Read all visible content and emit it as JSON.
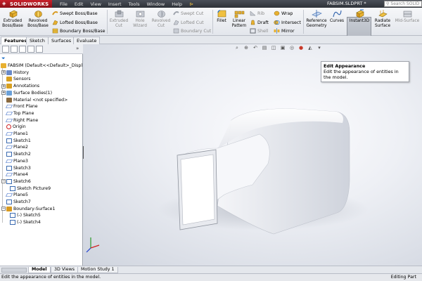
{
  "app": {
    "brand": "SOLIDWORKS",
    "document_title": "FABSIM.SLDPRT *",
    "search_placeholder": "Search SOLID"
  },
  "menu": {
    "items": [
      "File",
      "Edit",
      "View",
      "Insert",
      "Tools",
      "Window",
      "Help"
    ],
    "pin_icon": "pushpin-icon"
  },
  "ribbon": {
    "extruded_boss": "Extruded Boss/Base",
    "revolved_boss": "Revolved Boss/Base",
    "swept_boss": "Swept Boss/Base",
    "lofted_boss": "Lofted Boss/Base",
    "boundary_boss": "Boundary Boss/Base",
    "extruded_cut": "Extruded Cut",
    "hole_wizard": "Hole Wizard",
    "revolved_cut": "Revolved Cut",
    "swept_cut": "Swept Cut",
    "lofted_cut": "Lofted Cut",
    "boundary_cut": "Boundary Cut",
    "fillet": "Fillet",
    "linear_pattern": "Linear Pattern",
    "rib": "Rib",
    "draft": "Draft",
    "shell": "Shell",
    "wrap": "Wrap",
    "intersect": "Intersect",
    "mirror": "Mirror",
    "reference_geometry": "Reference Geometry",
    "curves": "Curves",
    "instant3d": "Instant3D",
    "radiate_surface": "Radiate Surface",
    "mid_surface": "Mid-Surface"
  },
  "tabs": [
    "Features",
    "Sketch",
    "Surfaces",
    "Evaluate"
  ],
  "tree": [
    {
      "label": "FABSIM  (Default<<Default>_Displ",
      "icon": "part-icon",
      "indent": 0
    },
    {
      "label": "History",
      "icon": "history-icon",
      "indent": 1,
      "expandable": true
    },
    {
      "label": "Sensors",
      "icon": "sensor-icon",
      "indent": 1
    },
    {
      "label": "Annotations",
      "icon": "annotations-icon",
      "indent": 1,
      "expandable": true
    },
    {
      "label": "Surface Bodies(1)",
      "icon": "surface-bodies-icon",
      "indent": 1,
      "expandable": true
    },
    {
      "label": "Material <not specified>",
      "icon": "material-icon",
      "indent": 1
    },
    {
      "label": "Front Plane",
      "icon": "plane-icon",
      "indent": 1
    },
    {
      "label": "Top Plane",
      "icon": "plane-icon",
      "indent": 1
    },
    {
      "label": "Right Plane",
      "icon": "plane-icon",
      "indent": 1
    },
    {
      "label": "Origin",
      "icon": "origin-icon",
      "indent": 1
    },
    {
      "label": "Plane1",
      "icon": "plane-icon",
      "indent": 1
    },
    {
      "label": "Sketch1",
      "icon": "sketch-icon",
      "indent": 1
    },
    {
      "label": "Plane2",
      "icon": "plane-icon",
      "indent": 1
    },
    {
      "label": "Sketch2",
      "icon": "sketch-icon",
      "indent": 1
    },
    {
      "label": "Plane3",
      "icon": "plane-icon",
      "indent": 1
    },
    {
      "label": "Sketch3",
      "icon": "sketch-icon",
      "indent": 1
    },
    {
      "label": "Plane4",
      "icon": "plane-icon",
      "indent": 1
    },
    {
      "label": "Sketch6",
      "icon": "sketch-icon",
      "indent": 1,
      "expandable": true,
      "expanded": true
    },
    {
      "label": "Sketch Picture9",
      "icon": "sketch-picture-icon",
      "indent": 2
    },
    {
      "label": "Plane5",
      "icon": "plane-icon",
      "indent": 1
    },
    {
      "label": "Sketch7",
      "icon": "sketch-icon",
      "indent": 1
    },
    {
      "label": "Boundary-Surface1",
      "icon": "boundary-surface-icon",
      "indent": 1,
      "expandable": true,
      "expanded": true
    },
    {
      "label": "(-) Sketch5",
      "icon": "sketch-icon",
      "indent": 2
    },
    {
      "label": "(-) Sketch4",
      "icon": "sketch-icon",
      "indent": 2
    }
  ],
  "tooltip": {
    "title": "Edit Appearance",
    "body": "Edit the appearance of entities in the model."
  },
  "bottom_tabs": [
    "Model",
    "3D Views",
    "Motion Study 1"
  ],
  "status": {
    "message": "Edit the appearance of entities in the model.",
    "mode": "Editing Part"
  },
  "colors": {
    "logo_red": "#c8202a",
    "accent_blue": "#1a6bc4",
    "model_surface": "#f2f3f6"
  }
}
